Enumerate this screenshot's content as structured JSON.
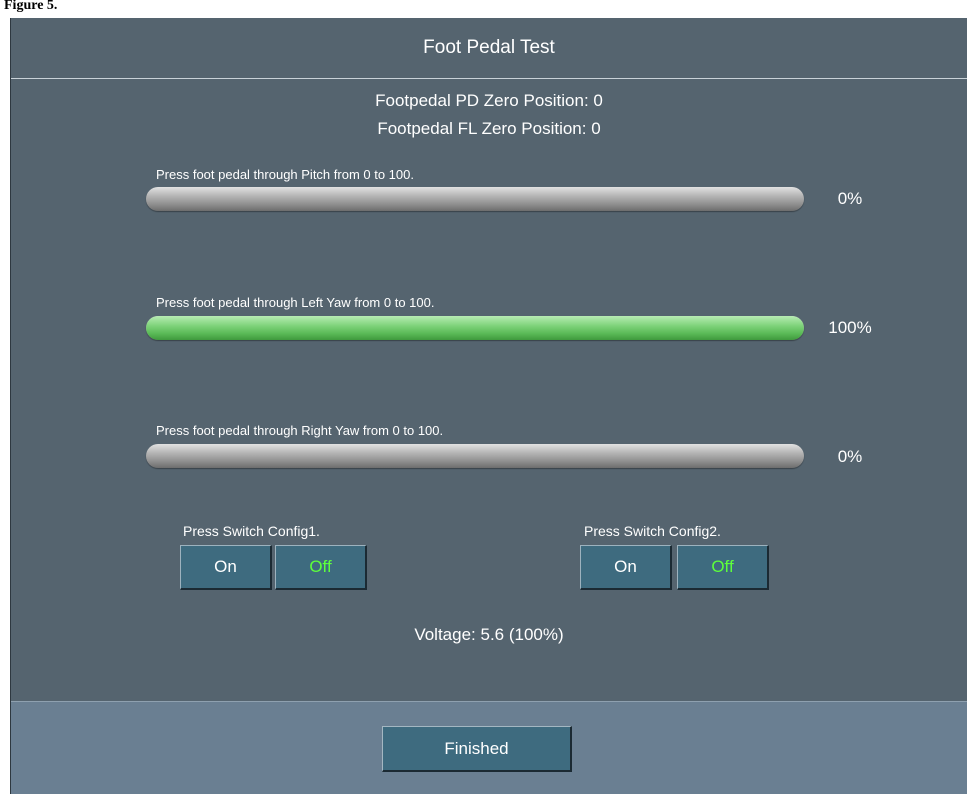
{
  "caption": "Figure 5.",
  "window": {
    "title": "Foot Pedal Test"
  },
  "zero_positions": {
    "pd": "Footpedal PD Zero Position: 0",
    "fl": "Footpedal FL Zero Position: 0"
  },
  "bars": [
    {
      "prompt": "Press foot pedal through Pitch from 0 to 100.",
      "percent_label": "0%",
      "progress": 0
    },
    {
      "prompt": "Press foot pedal through Left Yaw from 0 to 100.",
      "percent_label": "100%",
      "progress": 100
    },
    {
      "prompt": "Press foot pedal through Right Yaw from 0 to 100.",
      "percent_label": "0%",
      "progress": 0
    }
  ],
  "switches": [
    {
      "label": "Press Switch Config1.",
      "on_label": "On",
      "off_label": "Off",
      "state": "off"
    },
    {
      "label": "Press Switch Config2.",
      "on_label": "On",
      "off_label": "Off",
      "state": "off"
    }
  ],
  "voltage": "Voltage: 5.6 (100%)",
  "footer": {
    "finished_label": "Finished"
  },
  "colors": {
    "panel_bg": "#55646f",
    "footer_bg": "#6a7f92",
    "button_bg": "#3e6b7f",
    "active_off_text": "#5dff3c",
    "progress_fill": "#7fd37b",
    "progress_track": "#b2b2b2"
  }
}
